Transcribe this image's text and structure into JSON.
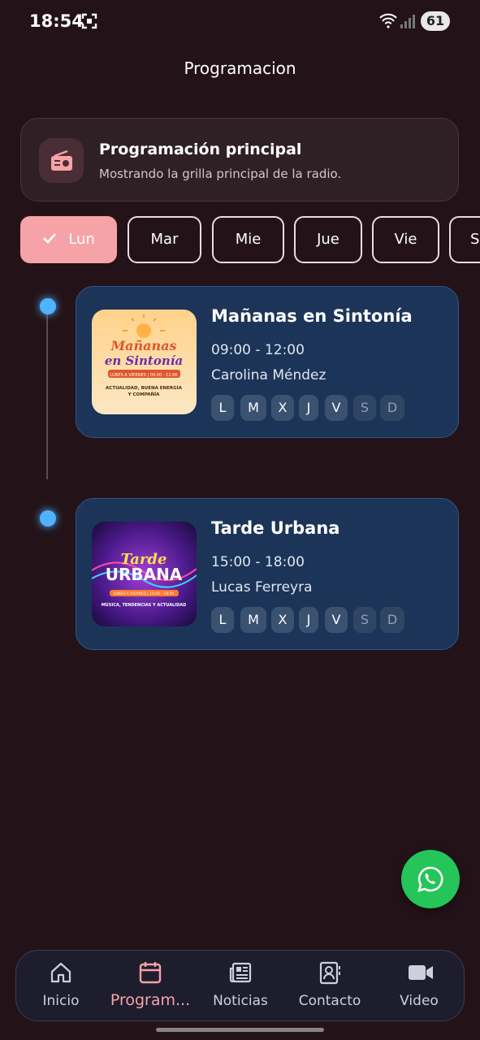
{
  "status_bar": {
    "time": "18:54",
    "battery": "61",
    "icons": [
      "screenshot-icon",
      "wifi-icon",
      "signal-icon",
      "battery-icon"
    ]
  },
  "page": {
    "title": "Programacion"
  },
  "main_card": {
    "title": "Programación principal",
    "subtitle": "Mostrando la grilla principal de la radio.",
    "icon": "radio-icon"
  },
  "days": [
    {
      "label": "Lun",
      "selected": true
    },
    {
      "label": "Mar",
      "selected": false
    },
    {
      "label": "Mie",
      "selected": false
    },
    {
      "label": "Jue",
      "selected": false
    },
    {
      "label": "Vie",
      "selected": false
    },
    {
      "label": "S",
      "selected": false
    }
  ],
  "programs": [
    {
      "name": "Mañanas en Sintonía",
      "time": "09:00 - 12:00",
      "host": "Carolina Méndez",
      "image": {
        "title_line1": "Mañanas",
        "title_line2": "en Sintonía",
        "band": "LUNES A VIERNES | 09:00 - 12:00",
        "tagline1": "ACTUALIDAD, BUENA ENERGÍA",
        "tagline2": "Y COMPAÑÍA"
      },
      "days": [
        "L",
        "M",
        "X",
        "J",
        "V",
        "S",
        "D"
      ],
      "active_days": [
        true,
        true,
        true,
        true,
        true,
        false,
        false
      ]
    },
    {
      "name": "Tarde Urbana",
      "time": "15:00 - 18:00",
      "host": "Lucas Ferreyra",
      "image": {
        "title_line1": "Tarde",
        "title_line2": "URBANA",
        "band": "LUNES A VIERNES | 15:00 - 18:00",
        "tagline1": "MÚSICA, TENDENCIAS Y ACTUALIDAD",
        "tagline2": ""
      },
      "days": [
        "L",
        "M",
        "X",
        "J",
        "V",
        "S",
        "D"
      ],
      "active_days": [
        true,
        true,
        true,
        true,
        true,
        false,
        false
      ]
    }
  ],
  "fab": {
    "icon": "whatsapp-icon",
    "color": "#25c55a"
  },
  "nav": [
    {
      "label": "Inicio",
      "icon": "home-icon",
      "active": false
    },
    {
      "label": "Program...",
      "icon": "calendar-icon",
      "active": true
    },
    {
      "label": "Noticias",
      "icon": "news-icon",
      "active": false
    },
    {
      "label": "Contacto",
      "icon": "contact-icon",
      "active": false
    },
    {
      "label": "Video",
      "icon": "video-icon",
      "active": false
    }
  ],
  "colors": {
    "background": "#231319",
    "accent": "#f6a3a8",
    "card_blue": "#1c3458",
    "timeline_dot": "#4fb3ff"
  }
}
